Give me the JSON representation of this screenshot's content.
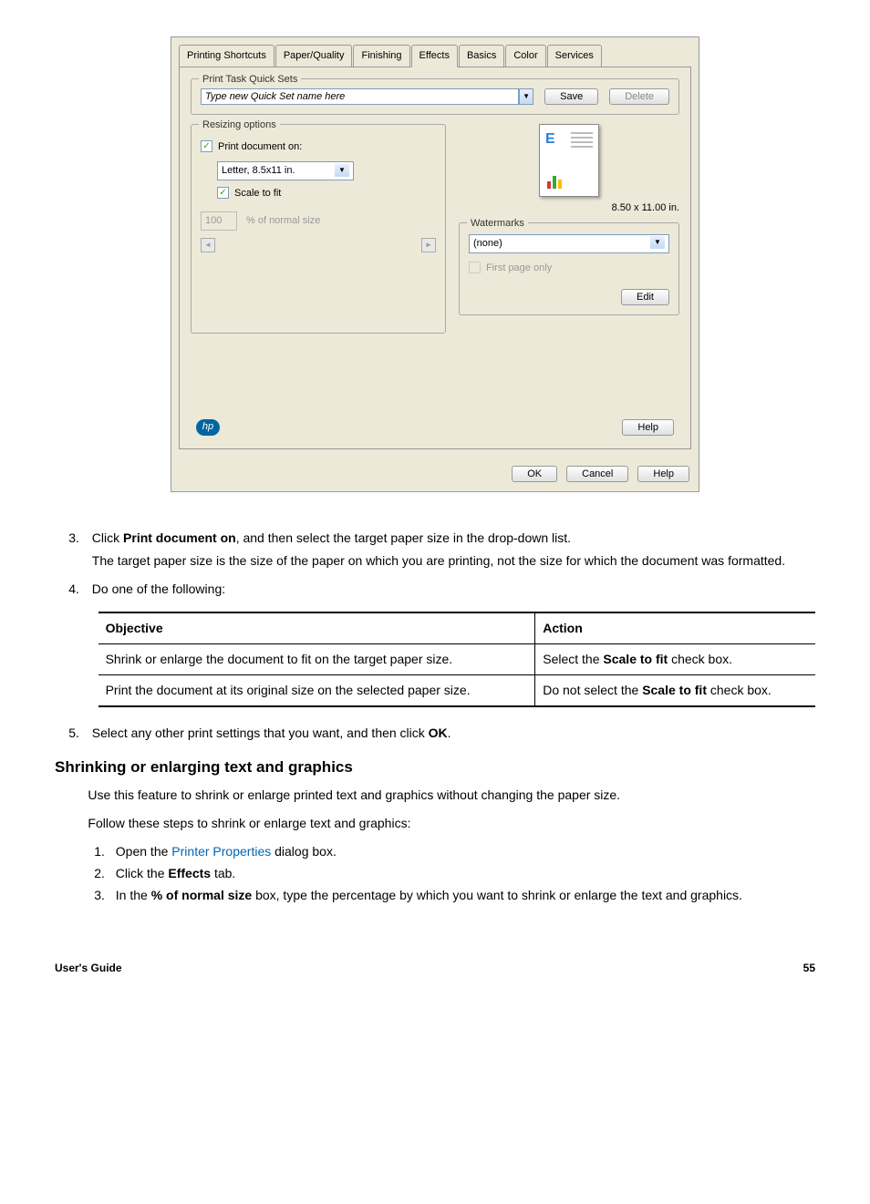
{
  "dialog": {
    "tabs": [
      "Printing Shortcuts",
      "Paper/Quality",
      "Finishing",
      "Effects",
      "Basics",
      "Color",
      "Services"
    ],
    "active_tab": "Effects",
    "quicksets": {
      "legend": "Print Task Quick Sets",
      "placeholder": "Type new Quick Set name here",
      "save": "Save",
      "delete": "Delete"
    },
    "resizing": {
      "legend": "Resizing options",
      "print_doc_on": "Print document on:",
      "paper": "Letter, 8.5x11 in.",
      "scale_to_fit": "Scale to fit",
      "percent_value": "100",
      "percent_label": "% of normal size"
    },
    "preview": {
      "dimensions": "8.50 x 11.00 in."
    },
    "watermarks": {
      "legend": "Watermarks",
      "selected": "(none)",
      "first_page_only": "First page only",
      "edit": "Edit"
    },
    "help": "Help",
    "ok": "OK",
    "cancel": "Cancel",
    "help2": "Help",
    "hp": "hp"
  },
  "steps": {
    "s3_a": "Click ",
    "s3_b": "Print document on",
    "s3_c": ", and then select the target paper size in the drop-down list.",
    "s3_note": "The target paper size is the size of the paper on which you are printing, not the size for which the document was formatted.",
    "s4": "Do one of the following:",
    "table": {
      "h1": "Objective",
      "h2": "Action",
      "r1c1": "Shrink or enlarge the document to fit on the target paper size.",
      "r1c2a": "Select the ",
      "r1c2b": "Scale to fit",
      "r1c2c": " check box.",
      "r2c1": "Print the document at its original size on the selected paper size.",
      "r2c2a": "Do not select the ",
      "r2c2b": "Scale to fit",
      "r2c2c": " check box."
    },
    "s5a": "Select any other print settings that you want, and then click ",
    "s5b": "OK",
    "s5c": "."
  },
  "section2": {
    "heading": "Shrinking or enlarging text and graphics",
    "p1": "Use this feature to shrink or enlarge printed text and graphics without changing the paper size.",
    "p2": "Follow these steps to shrink or enlarge text and graphics:",
    "li1a": "Open the ",
    "li1b": "Printer Properties",
    "li1c": " dialog box.",
    "li2a": "Click the ",
    "li2b": "Effects",
    "li2c": " tab.",
    "li3a": "In the ",
    "li3b": "% of normal size",
    "li3c": " box, type the percentage by which you want to shrink or enlarge the text and graphics."
  },
  "footer": {
    "left": "User's Guide",
    "right": "55"
  }
}
